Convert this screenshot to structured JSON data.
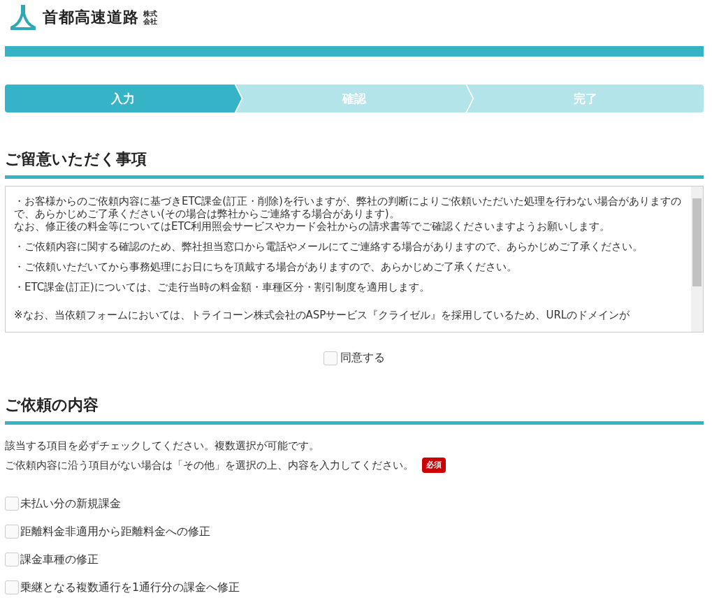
{
  "header": {
    "logo_text": "首都高速道路",
    "logo_suffix": [
      "株式",
      "会社"
    ]
  },
  "steps": [
    {
      "label": "入力",
      "selected": true
    },
    {
      "label": "確認",
      "selected": false
    },
    {
      "label": "完了",
      "selected": false
    }
  ],
  "notice": {
    "heading": "ご留意いただく事項",
    "paragraphs": [
      [
        "・お客様からのご依頼内容に基づきETC課金(訂正・削除)を行いますが、弊社の判断によりご依頼いただいた処理を行わない場合がありますので、あらかじめご了承ください(その場合は弊社からご連絡する場合があります)。",
        "なお、修正後の料金等についてはETC利用照会サービスやカード会社からの請求書等でご確認くださいますようお願いします。"
      ],
      [
        "・ご依頼内容に関する確認のため、弊社担当窓口から電話やメールにてご連絡する場合がありますので、あらかじめご了承ください。"
      ],
      [
        "・ご依頼いただいてから事務処理にお日にちを頂戴する場合がありますので、あらかじめご了承ください。"
      ],
      [
        "・ETC課金(訂正)については、ご走行当時の料金額・車種区分・割引制度を適用します。"
      ],
      [
        "※なお、当依頼フォームにおいては、トライコーン株式会社のASPサービス『クライゼル』を採用しているため、URLのドメインが"
      ]
    ]
  },
  "agree": {
    "label": "同意する",
    "checked": false
  },
  "request": {
    "heading": "ご依頼の内容",
    "instructions": [
      "該当する項目を必ずチェックしてください。複数選択が可能です。",
      "ご依頼内容に沿う項目がない場合は「その他」を選択の上、内容を入力してください。"
    ],
    "required_badge": "必須",
    "options": [
      {
        "label": "未払い分の新規課金",
        "checked": false
      },
      {
        "label": "距離料金非適用から距離料金への修正",
        "checked": false
      },
      {
        "label": "課金車種の修正",
        "checked": false
      },
      {
        "label": "乗継となる複数通行を1通行分の課金へ修正",
        "checked": false
      }
    ]
  }
}
